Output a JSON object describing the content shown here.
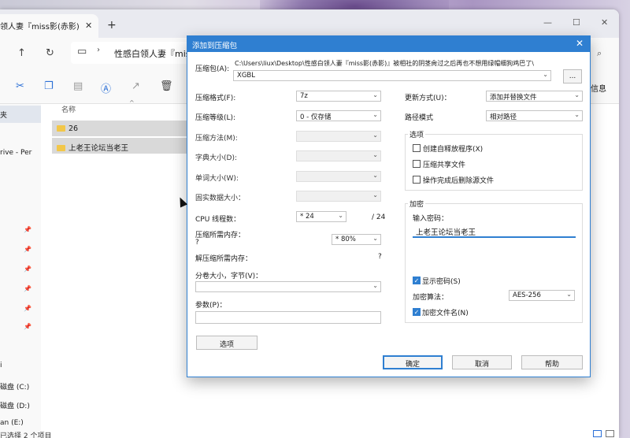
{
  "explorer": {
    "tab_title": "领人妻『miss影(赤影)",
    "breadcrumb": "性感白领人妻『miss",
    "info_label": "信息",
    "sidebar": [
      "夹",
      "rive - Per",
      "i",
      "磁盘 (C:)",
      "磁盘 (D:)",
      "an (E:)"
    ],
    "column_name": "名称",
    "files": [
      {
        "name": "26"
      },
      {
        "name": "上老王论坛当老王"
      }
    ],
    "status": "已选择 2 个项目"
  },
  "dialog": {
    "title": "添加到压缩包",
    "archive_label": "压缩包(A):",
    "archive_path": "C:\\Users\\liux\\Desktop\\性感白领人妻『miss影(赤影)』被相社的阴茎肏过之后再也不想用绿帽细狗鸡巴了\\",
    "archive_name": "XGBL",
    "browse_label": "...",
    "format_label": "压缩格式(F):",
    "format_value": "7z",
    "level_label": "压缩等级(L):",
    "level_value": "0 - 仅存储",
    "method_label": "压缩方法(M):",
    "dict_label": "字典大小(D):",
    "word_label": "单词大小(W):",
    "solid_label": "固实数据大小：",
    "cpu_label": "CPU 线程数：",
    "cpu_value": "* 24",
    "cpu_total": "/ 24",
    "mem_compress_label": "压缩所需内存：",
    "mem_compress_value": "?",
    "mem_percent": "* 80%",
    "mem_decompress_label": "解压缩所需内存：",
    "mem_decompress_value": "?",
    "split_label": "分卷大小，字节(V)：",
    "params_label": "参数(P)：",
    "options_button": "选项",
    "update_label": "更新方式(U)：",
    "update_value": "添加并替换文件",
    "path_label": "路径模式",
    "path_value": "相对路径",
    "options_group": "选项",
    "opt_sfx": "创建自释放程序(X)",
    "opt_shared": "压缩共享文件",
    "opt_delete": "操作完成后删除源文件",
    "encrypt_group": "加密",
    "pwd_label": "输入密码：",
    "pwd_value": "上老王论坛当老王",
    "show_pwd": "显示密码(S)",
    "enc_method_label": "加密算法：",
    "enc_method_value": "AES-256",
    "enc_names": "加密文件名(N)",
    "ok": "确定",
    "cancel": "取消",
    "help": "帮助"
  }
}
